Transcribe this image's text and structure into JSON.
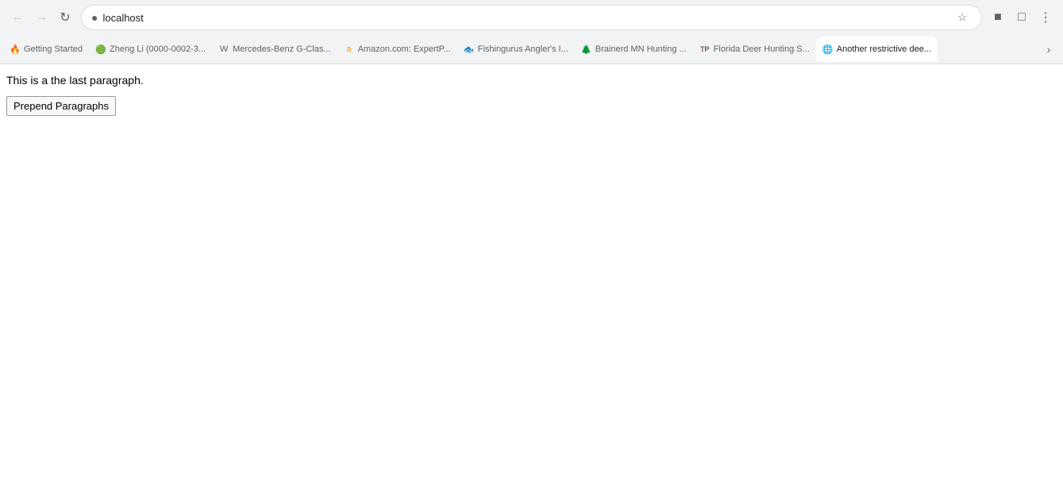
{
  "browser": {
    "address": "localhost",
    "tabs": [
      {
        "id": "tab-getting-started",
        "label": "Getting Started",
        "favicon": "🔥",
        "faviconClass": "favicon-circle-orange",
        "active": false
      },
      {
        "id": "tab-zheng-li",
        "label": "Zheng Li (0000-0002-3...",
        "favicon": "🟢",
        "faviconClass": "favicon-circle-green",
        "active": false
      },
      {
        "id": "tab-mercedes",
        "label": "Mercedes-Benz G-Clas...",
        "favicon": "W",
        "faviconClass": "",
        "active": false
      },
      {
        "id": "tab-amazon",
        "label": "Amazon.com: ExpertP...",
        "favicon": "a",
        "faviconClass": "favicon-amazon",
        "active": false
      },
      {
        "id": "tab-fishingurus",
        "label": "Fishingurus Angler's I...",
        "favicon": "🐟",
        "faviconClass": "favicon-fish",
        "active": false
      },
      {
        "id": "tab-brainerd",
        "label": "Brainerd MN Hunting ...",
        "favicon": "🌲",
        "faviconClass": "favicon-tree",
        "active": false
      },
      {
        "id": "tab-florida-deer",
        "label": "Florida Deer Hunting S...",
        "favicon": "TP",
        "faviconClass": "favicon-tp",
        "active": false
      },
      {
        "id": "tab-another",
        "label": "Another restrictive dee...",
        "favicon": "🌐",
        "faviconClass": "favicon-globe",
        "active": true
      }
    ],
    "nav": {
      "back_tooltip": "Back",
      "forward_tooltip": "Forward",
      "reload_tooltip": "Reload"
    }
  },
  "page": {
    "paragraph": "This is a the last paragraph.",
    "button_label": "Prepend Paragraphs"
  }
}
